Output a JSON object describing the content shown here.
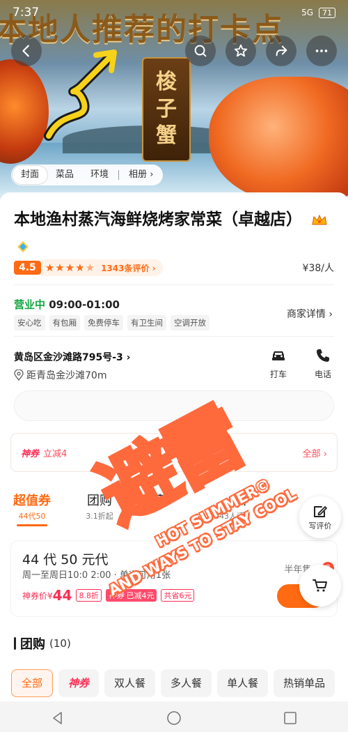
{
  "status_bar": {
    "time": "7:37",
    "signal": "5G",
    "battery": "71"
  },
  "hero": {
    "banner_text": "本地人推荐的打卡点",
    "sign_chars": [
      "梭",
      "子",
      "蟹"
    ],
    "tabs": [
      "封面",
      "菜品",
      "环境"
    ],
    "album_label": "相册"
  },
  "shop": {
    "name": "本地渔村蒸汽海鲜烧烤家常菜（卓越店）",
    "score": "4.5",
    "reviews": "1343条评价",
    "price": "¥38/人",
    "open_status": "营业中",
    "hours": "09:00-01:00",
    "facilities": [
      "安心吃",
      "有包厢",
      "免费停车",
      "有卫生间",
      "空调开放"
    ],
    "merchant_link": "商家详情",
    "address": "黄岛区金沙滩路795号-3",
    "distance": "距青岛金沙滩70m",
    "actions": [
      {
        "label": "打车"
      },
      {
        "label": "电话"
      }
    ]
  },
  "promo": {
    "tag": "神券",
    "text": "立减4",
    "more": "全部"
  },
  "deal_tabs": [
    {
      "title": "超值券",
      "sub": "44代50"
    },
    {
      "title": "团购",
      "sub": "3.1折起"
    },
    {
      "title": "菜",
      "sub": ""
    },
    {
      "title": "价",
      "sub": "1343人评"
    }
  ],
  "voucher": {
    "title": "44 代 50 元代",
    "subtitle": "周一至周日10:0  2:00 · 单次可用1张",
    "price_label": "神券价¥",
    "price": "44",
    "discount": "8.8折",
    "reduce_tag": "神券",
    "reduce_text": "已减4元",
    "total": "共省6元",
    "sold": "半年售 16",
    "badge": "8"
  },
  "floating": {
    "review_label": "写评价"
  },
  "group": {
    "title": "团购",
    "count": "(10)",
    "chips": [
      "全部",
      "神券",
      "双人餐",
      "多人餐",
      "单人餐",
      "热销单品"
    ]
  },
  "watermark": {
    "big": "避雷",
    "line1": "HOT SUMMER©",
    "line2": "AND WAYS TO STAY COOL"
  },
  "colors": {
    "accent": "#ff6a13",
    "promo_red": "#ff2d55",
    "open_green": "#13a642",
    "watermark": "#ff6a3d"
  }
}
